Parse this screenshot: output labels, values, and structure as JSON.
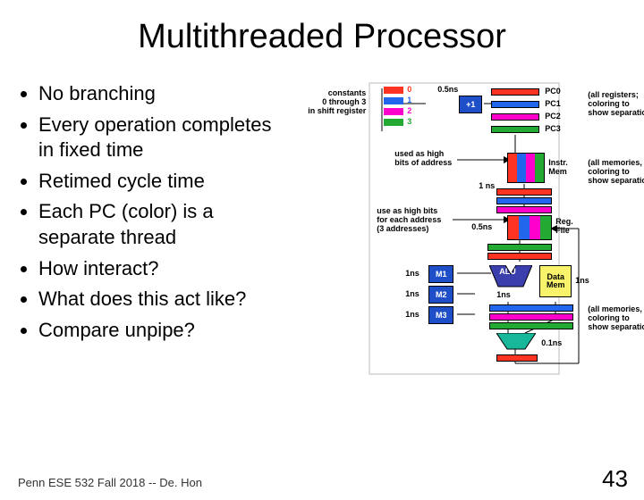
{
  "title": "Multithreaded Processor",
  "bullets": {
    "items": [
      "No branching",
      "Every operation completes in fixed time",
      "Retimed cycle time",
      "Each PC (color) is a separate thread",
      "How interact?",
      "What does this act like?",
      "Compare unpipe?"
    ]
  },
  "footer": "Penn ESE 532 Fall 2018 -- De. Hon",
  "page_number": "43",
  "diagram": {
    "constants_label": [
      "constants",
      "0 through 3",
      "in shift register"
    ],
    "shift_labels": [
      "0",
      "1",
      "2",
      "3"
    ],
    "plus_one": "+1",
    "half_ns": "0.5ns",
    "pc_labels": [
      "PC0",
      "PC1",
      "PC2",
      "PC3"
    ],
    "all_regs_label": [
      "(all registers;",
      "coloring to",
      "show separation)"
    ],
    "all_mems_label": [
      "(all memories,",
      "coloring to",
      "show separation)"
    ],
    "used_high": [
      "used as high",
      "bits of address"
    ],
    "instr_mem": [
      "Instr.",
      "Mem"
    ],
    "one_ns": "1 ns",
    "use_high": [
      "use as high bits",
      "for each address",
      "(3 addresses)"
    ],
    "reg_file": [
      "Reg.",
      "File"
    ],
    "m1": "M1",
    "m2": "M2",
    "m3": "M3",
    "alu": "ALU",
    "data_mem": [
      "Data",
      "Mem"
    ],
    "t_1ns": "1ns",
    "t_01ns": "0.1ns",
    "colors": {
      "pc0": "#ff3322",
      "pc1": "#2266ee",
      "pc2": "#ff00cc",
      "pc3": "#22aa33",
      "m_blue": "#1f4fc8",
      "alu_body": "#3b3fae",
      "dm_yellow": "#f8f36a",
      "mux_teal": "#17b79a"
    }
  }
}
